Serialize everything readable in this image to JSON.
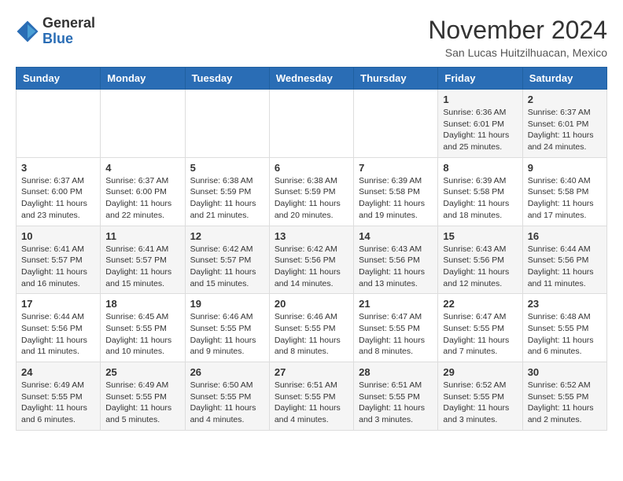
{
  "logo": {
    "general": "General",
    "blue": "Blue"
  },
  "title": "November 2024",
  "location": "San Lucas Huitzilhuacan, Mexico",
  "days_of_week": [
    "Sunday",
    "Monday",
    "Tuesday",
    "Wednesday",
    "Thursday",
    "Friday",
    "Saturday"
  ],
  "weeks": [
    [
      {
        "day": "",
        "content": ""
      },
      {
        "day": "",
        "content": ""
      },
      {
        "day": "",
        "content": ""
      },
      {
        "day": "",
        "content": ""
      },
      {
        "day": "",
        "content": ""
      },
      {
        "day": "1",
        "content": "Sunrise: 6:36 AM\nSunset: 6:01 PM\nDaylight: 11 hours and 25 minutes."
      },
      {
        "day": "2",
        "content": "Sunrise: 6:37 AM\nSunset: 6:01 PM\nDaylight: 11 hours and 24 minutes."
      }
    ],
    [
      {
        "day": "3",
        "content": "Sunrise: 6:37 AM\nSunset: 6:00 PM\nDaylight: 11 hours and 23 minutes."
      },
      {
        "day": "4",
        "content": "Sunrise: 6:37 AM\nSunset: 6:00 PM\nDaylight: 11 hours and 22 minutes."
      },
      {
        "day": "5",
        "content": "Sunrise: 6:38 AM\nSunset: 5:59 PM\nDaylight: 11 hours and 21 minutes."
      },
      {
        "day": "6",
        "content": "Sunrise: 6:38 AM\nSunset: 5:59 PM\nDaylight: 11 hours and 20 minutes."
      },
      {
        "day": "7",
        "content": "Sunrise: 6:39 AM\nSunset: 5:58 PM\nDaylight: 11 hours and 19 minutes."
      },
      {
        "day": "8",
        "content": "Sunrise: 6:39 AM\nSunset: 5:58 PM\nDaylight: 11 hours and 18 minutes."
      },
      {
        "day": "9",
        "content": "Sunrise: 6:40 AM\nSunset: 5:58 PM\nDaylight: 11 hours and 17 minutes."
      }
    ],
    [
      {
        "day": "10",
        "content": "Sunrise: 6:41 AM\nSunset: 5:57 PM\nDaylight: 11 hours and 16 minutes."
      },
      {
        "day": "11",
        "content": "Sunrise: 6:41 AM\nSunset: 5:57 PM\nDaylight: 11 hours and 15 minutes."
      },
      {
        "day": "12",
        "content": "Sunrise: 6:42 AM\nSunset: 5:57 PM\nDaylight: 11 hours and 15 minutes."
      },
      {
        "day": "13",
        "content": "Sunrise: 6:42 AM\nSunset: 5:56 PM\nDaylight: 11 hours and 14 minutes."
      },
      {
        "day": "14",
        "content": "Sunrise: 6:43 AM\nSunset: 5:56 PM\nDaylight: 11 hours and 13 minutes."
      },
      {
        "day": "15",
        "content": "Sunrise: 6:43 AM\nSunset: 5:56 PM\nDaylight: 11 hours and 12 minutes."
      },
      {
        "day": "16",
        "content": "Sunrise: 6:44 AM\nSunset: 5:56 PM\nDaylight: 11 hours and 11 minutes."
      }
    ],
    [
      {
        "day": "17",
        "content": "Sunrise: 6:44 AM\nSunset: 5:56 PM\nDaylight: 11 hours and 11 minutes."
      },
      {
        "day": "18",
        "content": "Sunrise: 6:45 AM\nSunset: 5:55 PM\nDaylight: 11 hours and 10 minutes."
      },
      {
        "day": "19",
        "content": "Sunrise: 6:46 AM\nSunset: 5:55 PM\nDaylight: 11 hours and 9 minutes."
      },
      {
        "day": "20",
        "content": "Sunrise: 6:46 AM\nSunset: 5:55 PM\nDaylight: 11 hours and 8 minutes."
      },
      {
        "day": "21",
        "content": "Sunrise: 6:47 AM\nSunset: 5:55 PM\nDaylight: 11 hours and 8 minutes."
      },
      {
        "day": "22",
        "content": "Sunrise: 6:47 AM\nSunset: 5:55 PM\nDaylight: 11 hours and 7 minutes."
      },
      {
        "day": "23",
        "content": "Sunrise: 6:48 AM\nSunset: 5:55 PM\nDaylight: 11 hours and 6 minutes."
      }
    ],
    [
      {
        "day": "24",
        "content": "Sunrise: 6:49 AM\nSunset: 5:55 PM\nDaylight: 11 hours and 6 minutes."
      },
      {
        "day": "25",
        "content": "Sunrise: 6:49 AM\nSunset: 5:55 PM\nDaylight: 11 hours and 5 minutes."
      },
      {
        "day": "26",
        "content": "Sunrise: 6:50 AM\nSunset: 5:55 PM\nDaylight: 11 hours and 4 minutes."
      },
      {
        "day": "27",
        "content": "Sunrise: 6:51 AM\nSunset: 5:55 PM\nDaylight: 11 hours and 4 minutes."
      },
      {
        "day": "28",
        "content": "Sunrise: 6:51 AM\nSunset: 5:55 PM\nDaylight: 11 hours and 3 minutes."
      },
      {
        "day": "29",
        "content": "Sunrise: 6:52 AM\nSunset: 5:55 PM\nDaylight: 11 hours and 3 minutes."
      },
      {
        "day": "30",
        "content": "Sunrise: 6:52 AM\nSunset: 5:55 PM\nDaylight: 11 hours and 2 minutes."
      }
    ]
  ]
}
